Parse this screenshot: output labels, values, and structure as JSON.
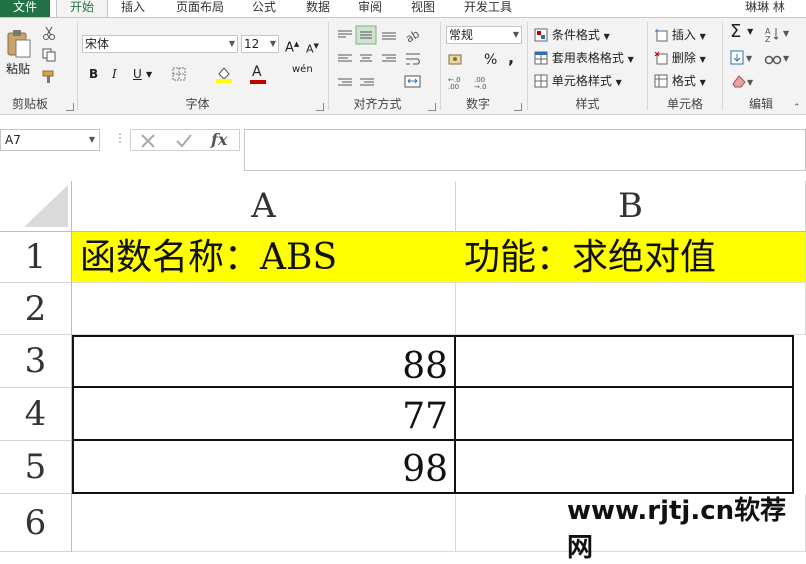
{
  "tabs": {
    "file": "文件",
    "home": "开始",
    "insert": "插入",
    "page_layout": "页面布局",
    "formulas": "公式",
    "data": "数据",
    "review": "审阅",
    "view": "视图",
    "developer": "开发工具",
    "user": "琳琳 林"
  },
  "ribbon": {
    "clipboard": {
      "paste": "粘贴",
      "group": "剪贴板"
    },
    "font": {
      "name": "宋体",
      "size": "12",
      "bold": "B",
      "italic": "I",
      "underline": "U",
      "font_color_letter": "A",
      "phonetic": "wén",
      "group": "字体"
    },
    "alignment": {
      "group": "对齐方式"
    },
    "number": {
      "format": "常规",
      "percent": "%",
      "comma": ",",
      "group": "数字"
    },
    "styles": {
      "conditional": "条件格式",
      "table": "套用表格格式",
      "cell_styles": "单元格样式",
      "group": "样式"
    },
    "cells": {
      "insert": "插入",
      "delete": "删除",
      "format": "格式",
      "group": "单元格"
    },
    "editing": {
      "group": "编辑"
    }
  },
  "formula_bar": {
    "name_box": "A7",
    "formula": ""
  },
  "sheet": {
    "columns": [
      "A",
      "B"
    ],
    "rows": [
      "1",
      "2",
      "3",
      "4",
      "5",
      "6"
    ],
    "cells": {
      "A1": "函数名称：ABS",
      "B1": "功能：求绝对值",
      "A3": "88",
      "A4": "77",
      "A5": "98"
    }
  },
  "colors": {
    "file_tab": "#217346",
    "header_fill": "#ffff00"
  },
  "watermark": "www.rjtj.cn软荐网"
}
